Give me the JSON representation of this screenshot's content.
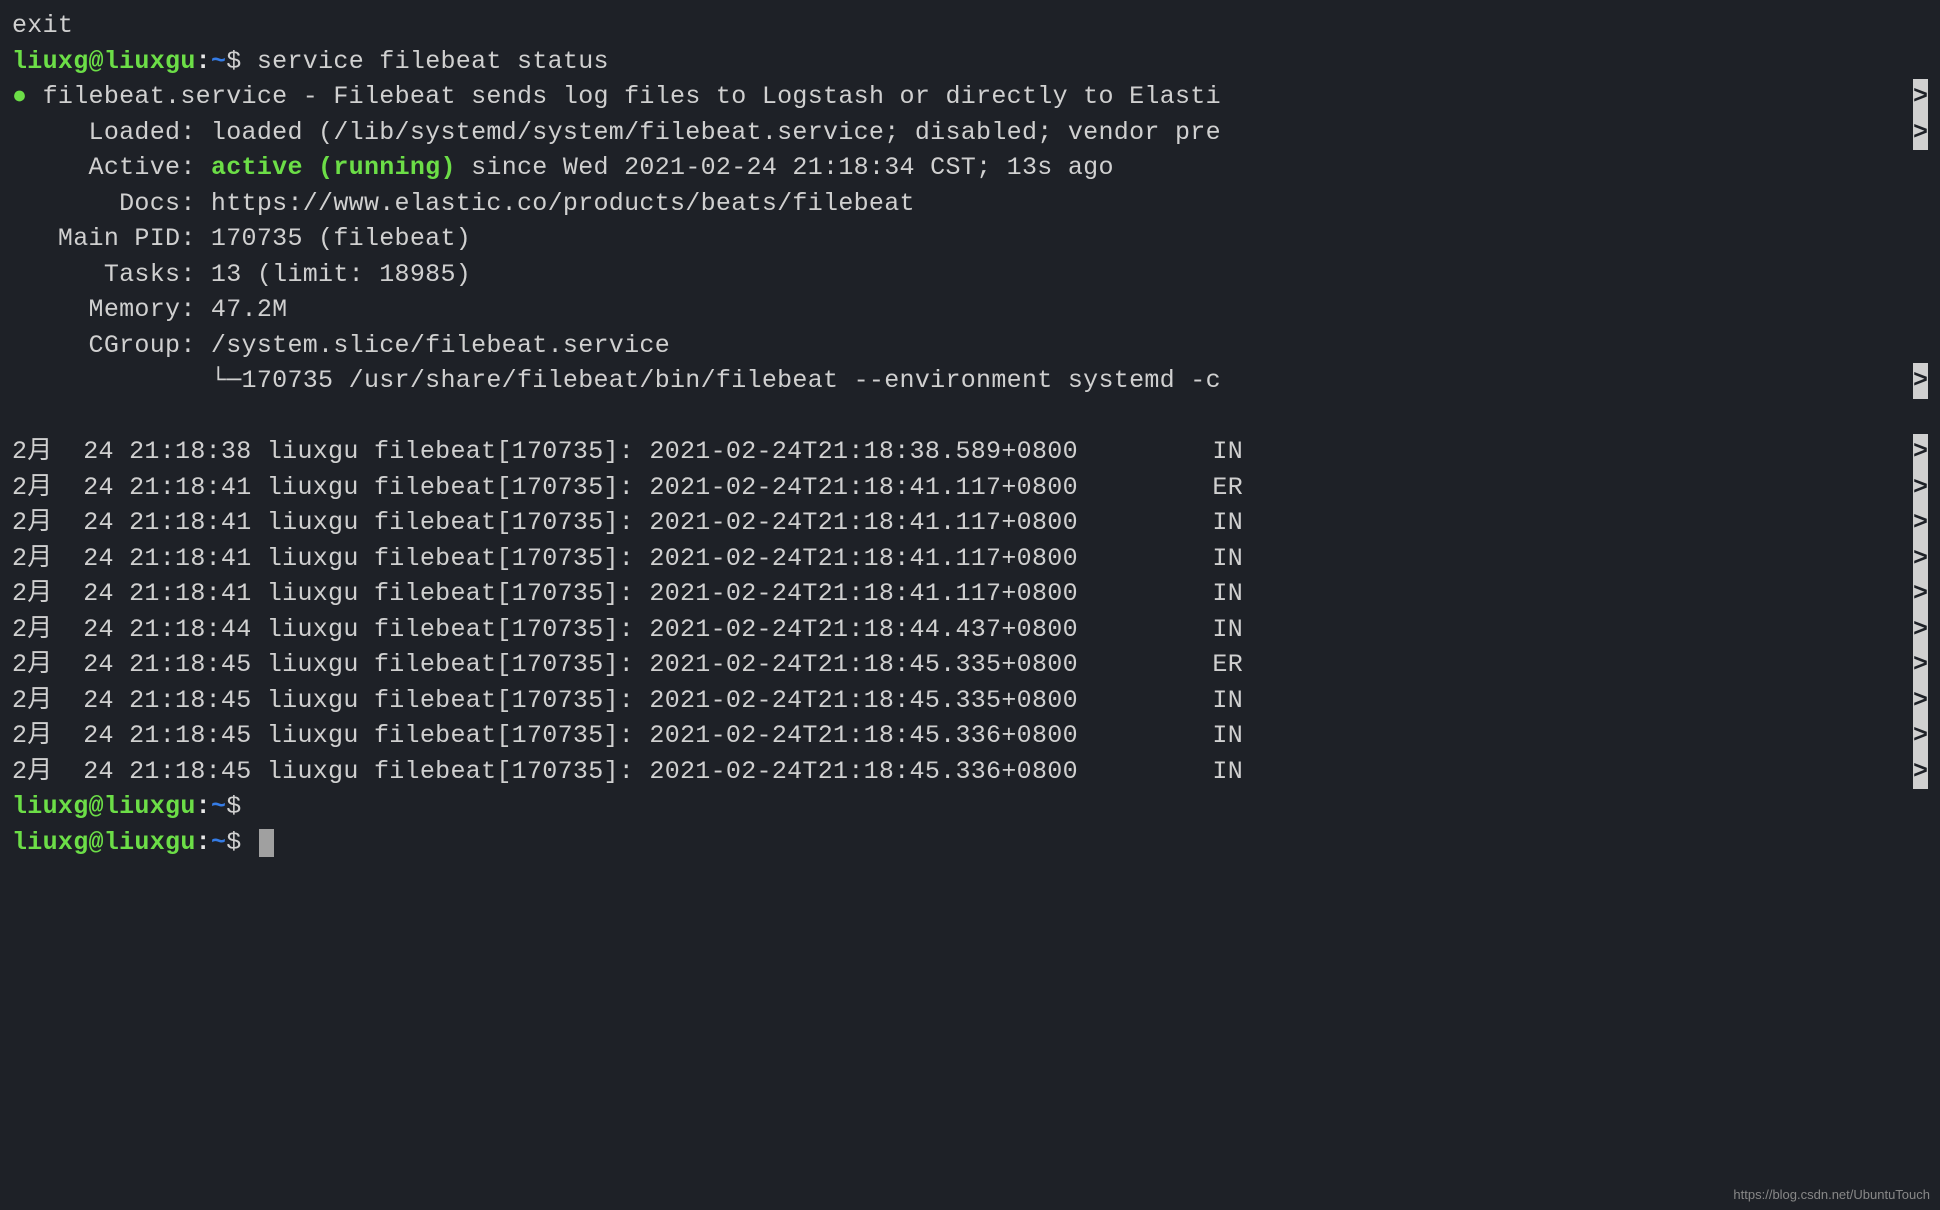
{
  "exit_line": "exit",
  "prompt": {
    "user": "liuxg@liuxgu",
    "sep": ":",
    "path": "~",
    "dollar": "$ "
  },
  "command": "service filebeat status",
  "service": {
    "bullet": "●",
    "name_line": " filebeat.service - Filebeat sends log files to Logstash or directly to Elasti",
    "loaded": "     Loaded: loaded (/lib/systemd/system/filebeat.service; disabled; vendor pre",
    "active_label": "     Active: ",
    "active_status": "active (running)",
    "active_since": " since Wed 2021-02-24 21:18:34 CST; 13s ago",
    "docs": "       Docs: https://www.elastic.co/products/beats/filebeat",
    "main_pid": "   Main PID: 170735 (filebeat)",
    "tasks": "      Tasks: 13 (limit: 18985)",
    "memory": "     Memory: 47.2M",
    "cgroup": "     CGroup: /system.slice/filebeat.service",
    "cgroup_child": "             └─170735 /usr/share/filebeat/bin/filebeat --environment systemd -c",
    "overflow": ">"
  },
  "logs": [
    {
      "body": "2月  24 21:18:38 liuxgu filebeat[170735]: 2021-02-24T21:18:38.589+0800",
      "tag": "IN",
      "ov": ">"
    },
    {
      "body": "2月  24 21:18:41 liuxgu filebeat[170735]: 2021-02-24T21:18:41.117+0800",
      "tag": "ER",
      "ov": ">"
    },
    {
      "body": "2月  24 21:18:41 liuxgu filebeat[170735]: 2021-02-24T21:18:41.117+0800",
      "tag": "IN",
      "ov": ">"
    },
    {
      "body": "2月  24 21:18:41 liuxgu filebeat[170735]: 2021-02-24T21:18:41.117+0800",
      "tag": "IN",
      "ov": ">"
    },
    {
      "body": "2月  24 21:18:41 liuxgu filebeat[170735]: 2021-02-24T21:18:41.117+0800",
      "tag": "IN",
      "ov": ">"
    },
    {
      "body": "2月  24 21:18:44 liuxgu filebeat[170735]: 2021-02-24T21:18:44.437+0800",
      "tag": "IN",
      "ov": ">"
    },
    {
      "body": "2月  24 21:18:45 liuxgu filebeat[170735]: 2021-02-24T21:18:45.335+0800",
      "tag": "ER",
      "ov": ">"
    },
    {
      "body": "2月  24 21:18:45 liuxgu filebeat[170735]: 2021-02-24T21:18:45.335+0800",
      "tag": "IN",
      "ov": ">"
    },
    {
      "body": "2月  24 21:18:45 liuxgu filebeat[170735]: 2021-02-24T21:18:45.336+0800",
      "tag": "IN",
      "ov": ">"
    },
    {
      "body": "2月  24 21:18:45 liuxgu filebeat[170735]: 2021-02-24T21:18:45.336+0800",
      "tag": "IN",
      "ov": ">"
    }
  ],
  "watermark": "https://blog.csdn.net/UbuntuTouch"
}
